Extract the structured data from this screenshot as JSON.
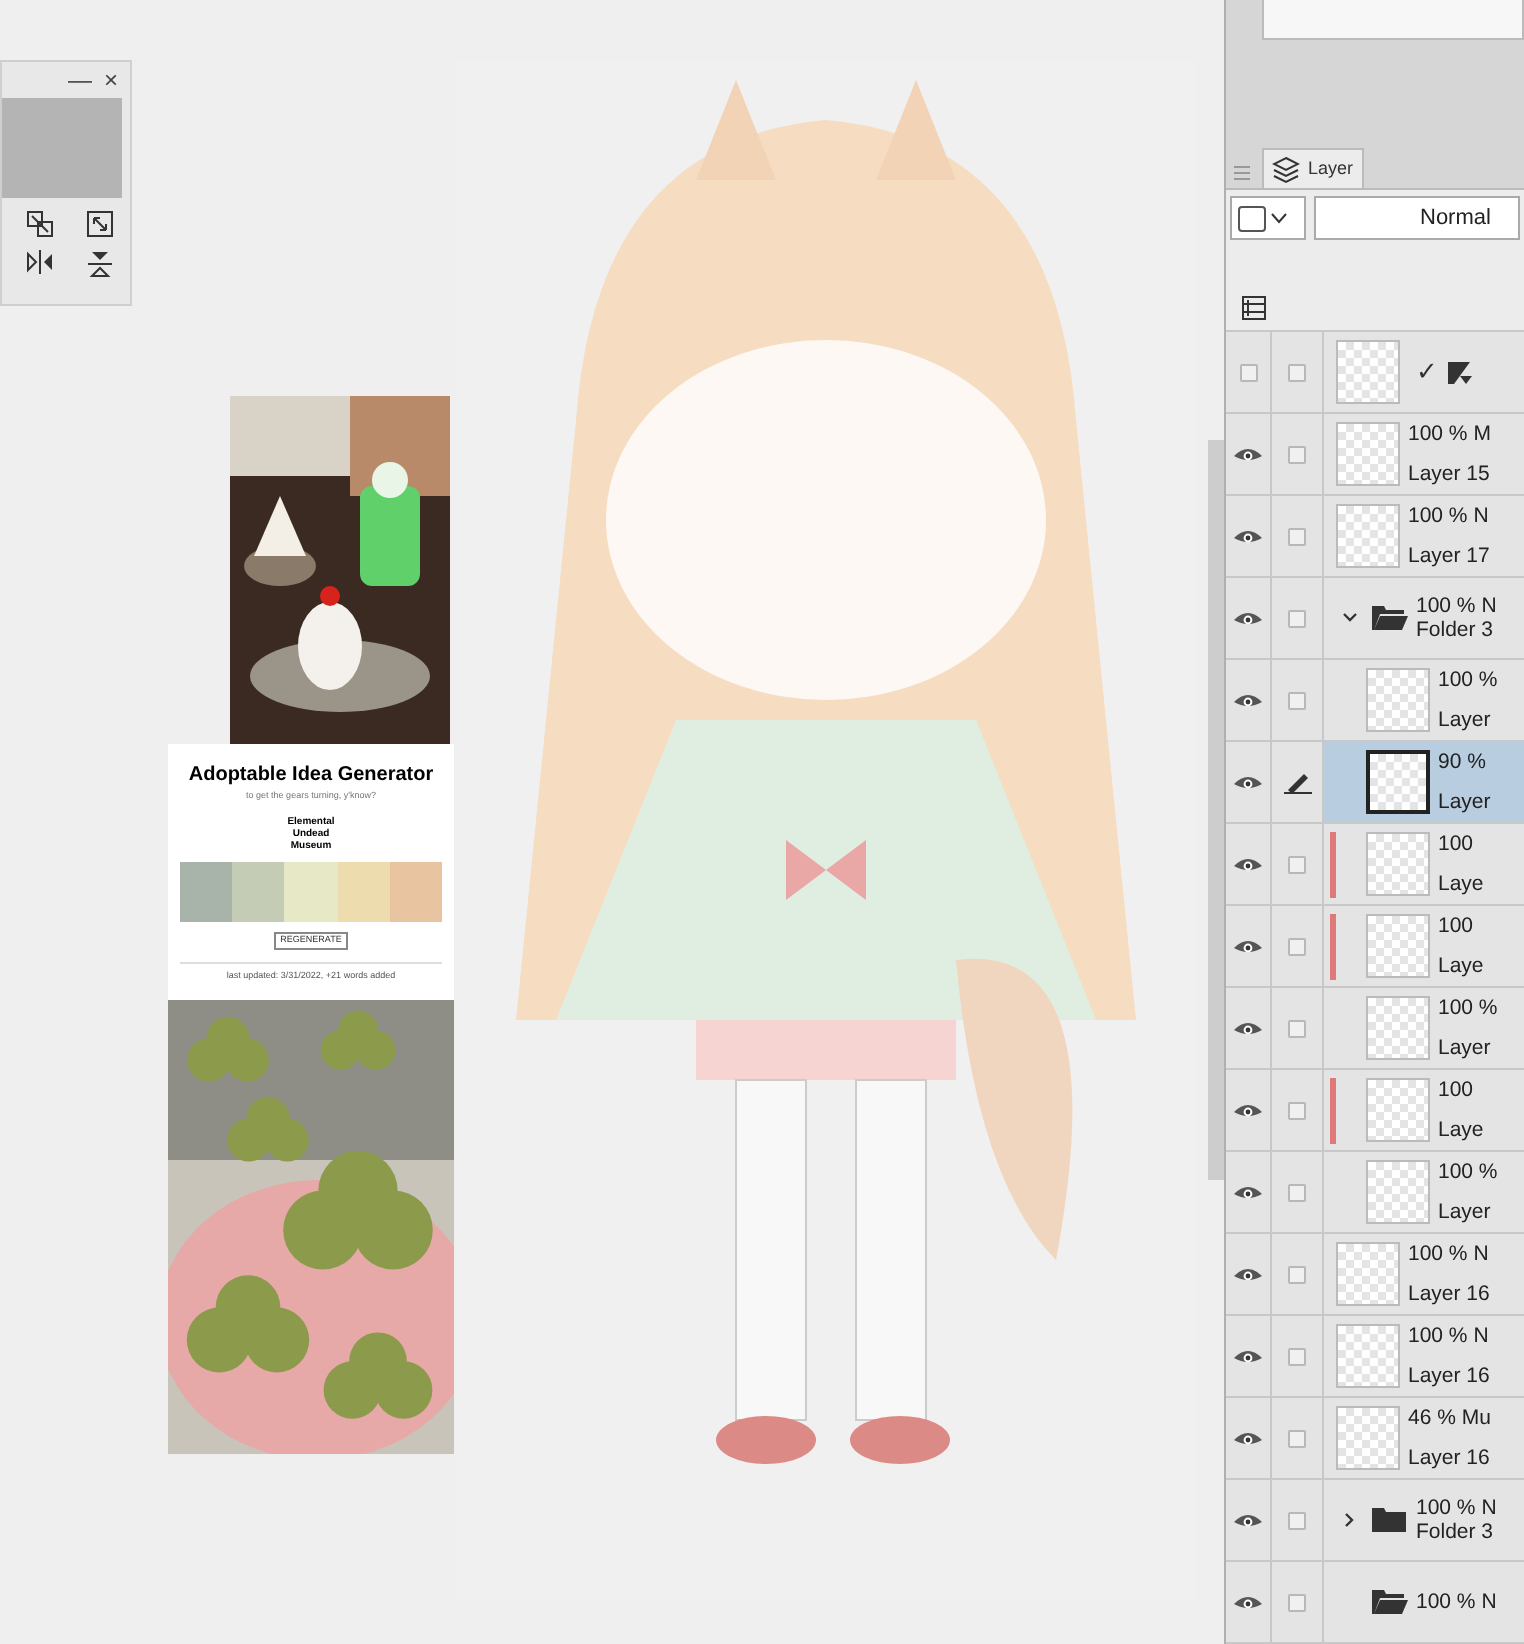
{
  "tool_window": {
    "minimize": "—",
    "close": "×"
  },
  "reference": {
    "title": "Adoptable Idea Generator",
    "subtitle": "to get the gears turning, y'know?",
    "words": [
      "Elemental",
      "Undead",
      "Museum"
    ],
    "palette": [
      {
        "color": "#a8b4aa"
      },
      {
        "color": "#c5ccb6"
      },
      {
        "color": "#e6e8c6"
      },
      {
        "color": "#ecdcae"
      },
      {
        "color": "#e8c4a0"
      }
    ],
    "button": "REGENERATE",
    "footer": "last updated: 3/31/2022, +21 words added"
  },
  "layer_panel": {
    "tab": {
      "label": "Layer",
      "selected": true
    },
    "blend_mode": "Normal",
    "layers": [
      {
        "kind": "special",
        "visible": false,
        "editing": false,
        "selected": false,
        "mark": "✓"
      },
      {
        "kind": "layer",
        "visible": true,
        "editing": false,
        "selected": false,
        "mode": "100 % M",
        "name": "Layer 15"
      },
      {
        "kind": "layer",
        "visible": true,
        "editing": false,
        "selected": false,
        "mode": "100 % N",
        "name": "Layer 17"
      },
      {
        "kind": "folder",
        "visible": true,
        "editing": false,
        "selected": false,
        "toggle": true,
        "expanded": true,
        "mode": "100 % N",
        "name": "Folder 3",
        "children": [
          {
            "kind": "layer",
            "visible": true,
            "editing": false,
            "selected": false,
            "clipped": false,
            "mode": "100 %",
            "name": "Layer"
          },
          {
            "kind": "layer",
            "visible": true,
            "editing": true,
            "selected": true,
            "clipped": false,
            "mode": "90 %",
            "name": "Layer"
          },
          {
            "kind": "layer",
            "visible": true,
            "editing": false,
            "selected": false,
            "clipped": true,
            "mode": "100",
            "name": "Laye"
          },
          {
            "kind": "layer",
            "visible": true,
            "editing": false,
            "selected": false,
            "clipped": true,
            "mode": "100",
            "name": "Laye"
          },
          {
            "kind": "layer",
            "visible": true,
            "editing": false,
            "selected": false,
            "clipped": false,
            "mode": "100 %",
            "name": "Layer"
          },
          {
            "kind": "layer",
            "visible": true,
            "editing": false,
            "selected": false,
            "clipped": true,
            "mode": "100",
            "name": "Laye"
          },
          {
            "kind": "layer",
            "visible": true,
            "editing": false,
            "selected": false,
            "clipped": false,
            "mode": "100 %",
            "name": "Layer"
          }
        ]
      },
      {
        "kind": "layer",
        "visible": true,
        "editing": false,
        "selected": false,
        "mode": "100 % N",
        "name": "Layer 16"
      },
      {
        "kind": "layer",
        "visible": true,
        "editing": false,
        "selected": false,
        "mode": "100 % N",
        "name": "Layer 16"
      },
      {
        "kind": "layer",
        "visible": true,
        "editing": false,
        "selected": false,
        "mode": "46 % Mu",
        "name": "Layer 16"
      },
      {
        "kind": "folder",
        "visible": true,
        "editing": false,
        "selected": false,
        "toggle": true,
        "expanded": false,
        "mode": "100 % N",
        "name": "Folder 3"
      },
      {
        "kind": "folder",
        "visible": true,
        "editing": false,
        "selected": false,
        "toggle": false,
        "expanded": true,
        "mode": "100 % N"
      }
    ]
  }
}
